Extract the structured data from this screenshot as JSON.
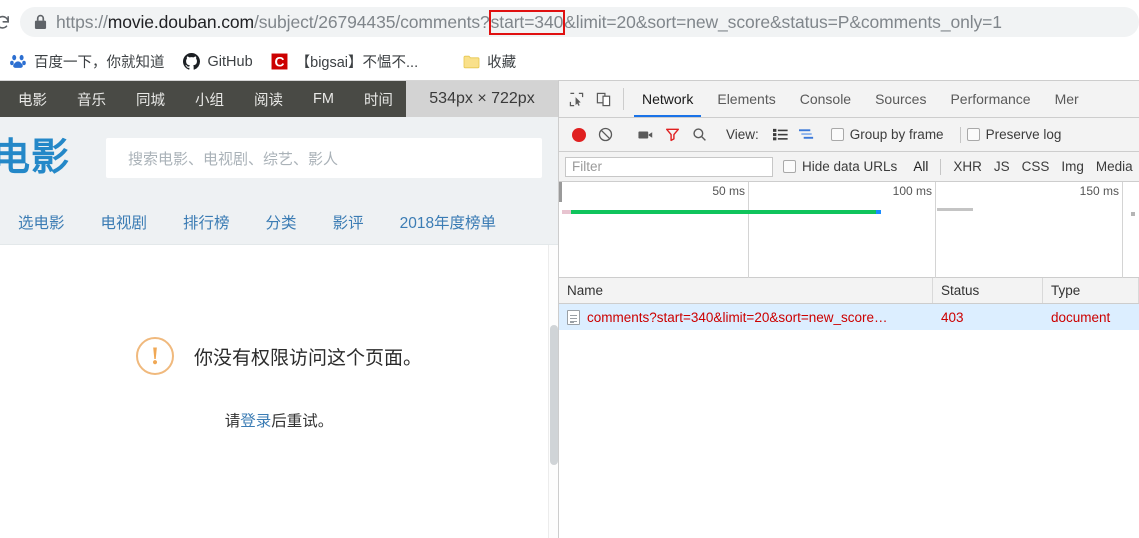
{
  "browser": {
    "reload_icon": "reload-icon",
    "omnibox": {
      "lock_icon": "lock-icon",
      "url_prefix": "https://",
      "url_domain": "movie.douban.com",
      "url_path_before": "/subject/26794435/comments?",
      "url_highlight": "start=340",
      "url_after": "&limit=20&sort=new_score&status=P&comments_only=1",
      "highlight_color": "#e01010"
    },
    "bookmarks": [
      {
        "label": "百度一下，你就知道",
        "icon": "baidu-icon"
      },
      {
        "label": "GitHub",
        "icon": "github-icon"
      },
      {
        "label": "【bigsai】不愠不...",
        "icon": "csdn-icon"
      },
      {
        "label": "收藏",
        "icon": "folder-icon"
      }
    ]
  },
  "page": {
    "topnav": [
      "电影",
      "音乐",
      "同城",
      "小组",
      "阅读",
      "FM",
      "时间"
    ],
    "dimension_badge": "534px × 722px",
    "logo": "电影",
    "search_placeholder": "搜索电影、电视剧、综艺、影人",
    "subnav": [
      "选电影",
      "电视剧",
      "排行榜",
      "分类",
      "影评",
      "2018年度榜单"
    ],
    "error": {
      "icon": "warning-icon",
      "title": "你没有权限访问这个页面。",
      "sub_prefix": "请",
      "sub_link": "登录",
      "sub_suffix": "后重试。"
    }
  },
  "devtools": {
    "inspect_icon": "inspect-element-icon",
    "device_icon": "device-toolbar-icon",
    "tabs": [
      {
        "label": "Network",
        "active": true
      },
      {
        "label": "Elements",
        "active": false
      },
      {
        "label": "Console",
        "active": false
      },
      {
        "label": "Sources",
        "active": false
      },
      {
        "label": "Performance",
        "active": false
      },
      {
        "label": "Mer",
        "active": false
      }
    ],
    "toolbar": {
      "record_icon": "record-icon",
      "clear_icon": "clear-icon",
      "camera_icon": "screenshot-camera-icon",
      "filter_icon": "filter-funnel-icon",
      "search_icon": "search-icon",
      "view_label": "View:",
      "list_view_icon": "list-view-icon",
      "waterfall_view_icon": "waterfall-view-icon",
      "group_by_frame": "Group by frame",
      "preserve_log": "Preserve log"
    },
    "filterbar": {
      "filter_placeholder": "Filter",
      "hide_data_urls": "Hide data URLs",
      "types": [
        "All",
        "XHR",
        "JS",
        "CSS",
        "Img",
        "Media"
      ]
    },
    "overview": {
      "ticks": [
        "50 ms",
        "100 ms",
        "150 ms"
      ]
    },
    "table": {
      "columns": [
        "Name",
        "Status",
        "Type"
      ],
      "rows": [
        {
          "icon": "document-icon",
          "name": "comments?start=340&limit=20&sort=new_score…",
          "status": "403",
          "type": "document"
        }
      ]
    }
  }
}
